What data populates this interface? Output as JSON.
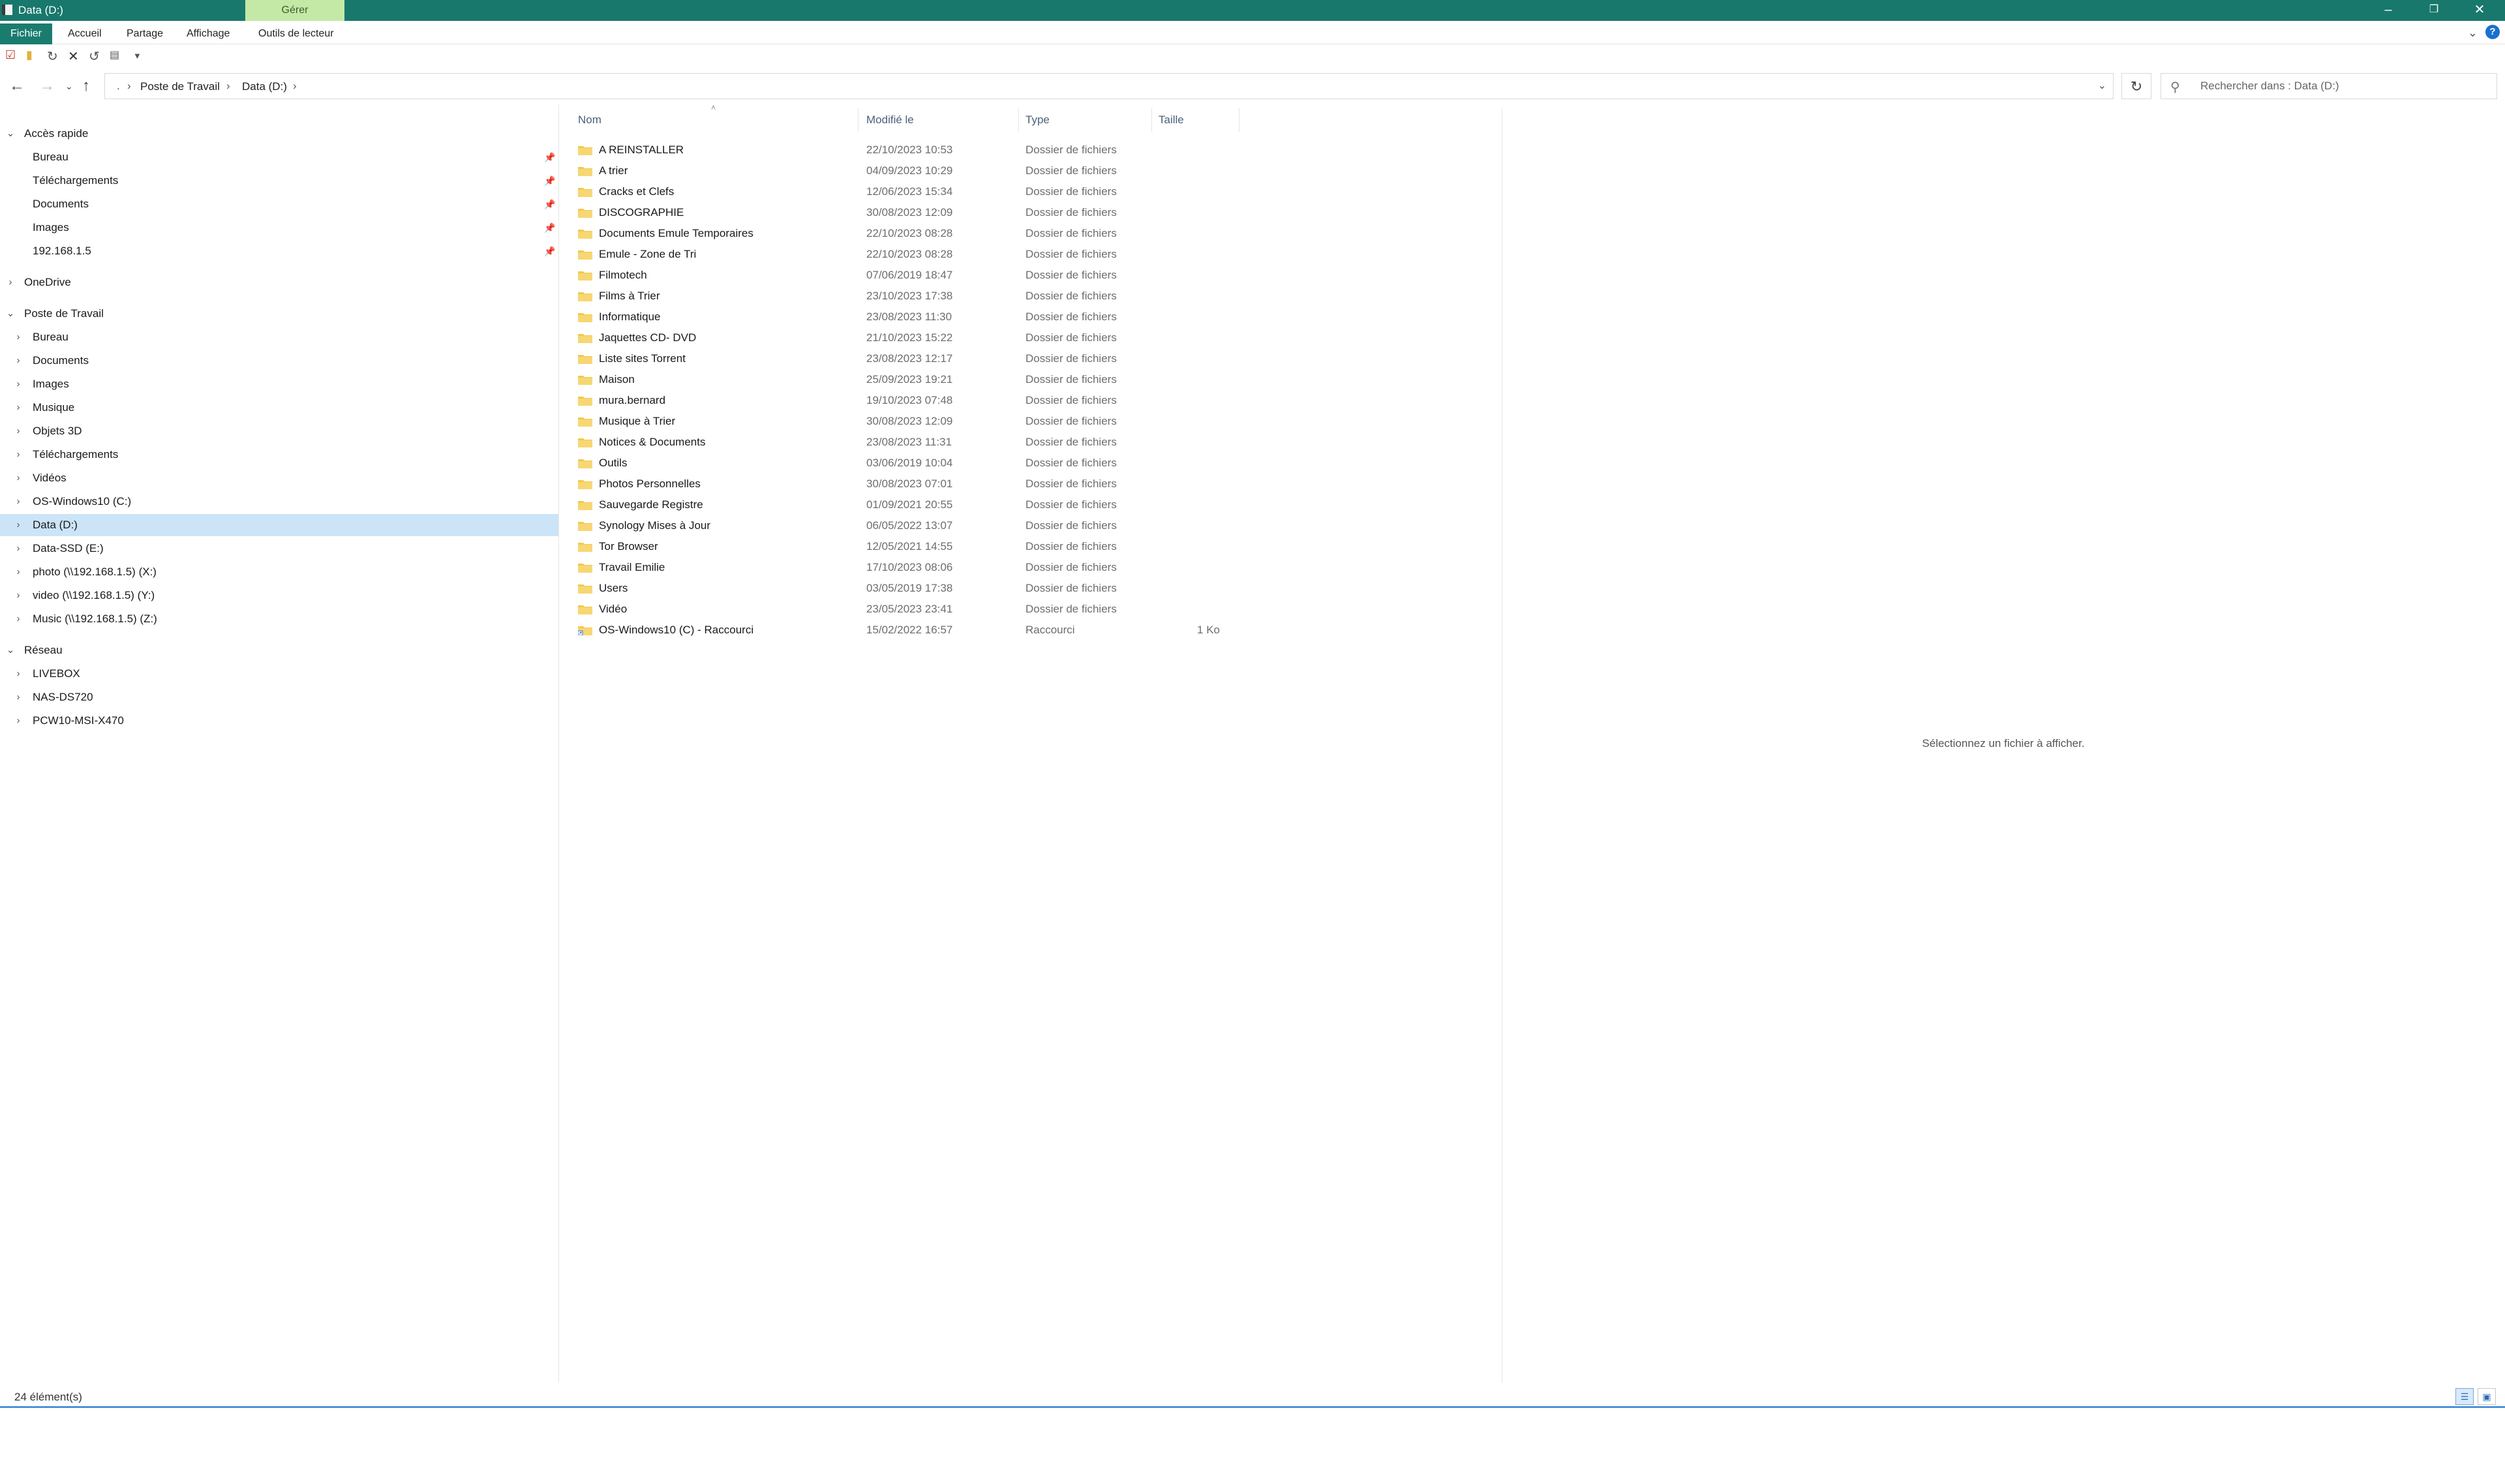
{
  "window": {
    "title": "Data (D:)",
    "context_tab": "Gérer",
    "accent_color": "#18786c"
  },
  "ribbon": {
    "tabs": [
      "Fichier",
      "Accueil",
      "Partage",
      "Affichage",
      "Outils de lecteur"
    ]
  },
  "address_bar": {
    "crumbs": [
      "Poste de Travail",
      "Data (D:)"
    ]
  },
  "search": {
    "placeholder": "Rechercher dans : Data (D:)"
  },
  "sidebar": {
    "quick_access": {
      "label": "Accès rapide",
      "items": [
        "Bureau",
        "Téléchargements",
        "Documents",
        "Images",
        "192.168.1.5"
      ]
    },
    "onedrive": "OneDrive",
    "this_pc": {
      "label": "Poste de Travail",
      "items": [
        "Bureau",
        "Documents",
        "Images",
        "Musique",
        "Objets 3D",
        "Téléchargements",
        "Vidéos",
        "OS-Windows10 (C:)",
        "Data (D:)",
        "Data-SSD (E:)",
        "photo (\\\\192.168.1.5) (X:)",
        "video (\\\\192.168.1.5) (Y:)",
        "Music (\\\\192.168.1.5) (Z:)"
      ],
      "selected": "Data (D:)"
    },
    "network": {
      "label": "Réseau",
      "items": [
        "LIVEBOX",
        "NAS-DS720",
        "PCW10-MSI-X470"
      ]
    }
  },
  "file_list": {
    "columns": [
      "Nom",
      "Modifié le",
      "Type",
      "Taille"
    ],
    "rows": [
      {
        "name": "A REINSTALLER",
        "date": "22/10/2023 10:53",
        "type": "Dossier de fichiers",
        "size": ""
      },
      {
        "name": "A trier",
        "date": "04/09/2023 10:29",
        "type": "Dossier de fichiers",
        "size": ""
      },
      {
        "name": "Cracks et Clefs",
        "date": "12/06/2023 15:34",
        "type": "Dossier de fichiers",
        "size": ""
      },
      {
        "name": "DISCOGRAPHIE",
        "date": "30/08/2023 12:09",
        "type": "Dossier de fichiers",
        "size": ""
      },
      {
        "name": "Documents Emule Temporaires",
        "date": "22/10/2023 08:28",
        "type": "Dossier de fichiers",
        "size": ""
      },
      {
        "name": "Emule - Zone de Tri",
        "date": "22/10/2023 08:28",
        "type": "Dossier de fichiers",
        "size": ""
      },
      {
        "name": "Filmotech",
        "date": "07/06/2019 18:47",
        "type": "Dossier de fichiers",
        "size": ""
      },
      {
        "name": "Films à Trier",
        "date": "23/10/2023 17:38",
        "type": "Dossier de fichiers",
        "size": ""
      },
      {
        "name": "Informatique",
        "date": "23/08/2023 11:30",
        "type": "Dossier de fichiers",
        "size": ""
      },
      {
        "name": "Jaquettes CD- DVD",
        "date": "21/10/2023 15:22",
        "type": "Dossier de fichiers",
        "size": ""
      },
      {
        "name": "Liste sites Torrent",
        "date": "23/08/2023 12:17",
        "type": "Dossier de fichiers",
        "size": ""
      },
      {
        "name": "Maison",
        "date": "25/09/2023 19:21",
        "type": "Dossier de fichiers",
        "size": ""
      },
      {
        "name": "mura.bernard",
        "date": "19/10/2023 07:48",
        "type": "Dossier de fichiers",
        "size": ""
      },
      {
        "name": "Musique à Trier",
        "date": "30/08/2023 12:09",
        "type": "Dossier de fichiers",
        "size": ""
      },
      {
        "name": "Notices & Documents",
        "date": "23/08/2023 11:31",
        "type": "Dossier de fichiers",
        "size": ""
      },
      {
        "name": "Outils",
        "date": "03/06/2019 10:04",
        "type": "Dossier de fichiers",
        "size": ""
      },
      {
        "name": "Photos Personnelles",
        "date": "30/08/2023 07:01",
        "type": "Dossier de fichiers",
        "size": ""
      },
      {
        "name": "Sauvegarde Registre",
        "date": "01/09/2021 20:55",
        "type": "Dossier de fichiers",
        "size": ""
      },
      {
        "name": "Synology Mises à Jour",
        "date": "06/05/2022 13:07",
        "type": "Dossier de fichiers",
        "size": ""
      },
      {
        "name": "Tor Browser",
        "date": "12/05/2021 14:55",
        "type": "Dossier de fichiers",
        "size": ""
      },
      {
        "name": "Travail Emilie",
        "date": "17/10/2023 08:06",
        "type": "Dossier de fichiers",
        "size": ""
      },
      {
        "name": "Users",
        "date": "03/05/2019 17:38",
        "type": "Dossier de fichiers",
        "size": ""
      },
      {
        "name": "Vidéo",
        "date": "23/05/2023 23:41",
        "type": "Dossier de fichiers",
        "size": ""
      },
      {
        "name": "OS-Windows10 (C) - Raccourci",
        "date": "15/02/2022 16:57",
        "type": "Raccourci",
        "size": "1 Ko"
      }
    ]
  },
  "preview": {
    "message": "Sélectionnez un fichier à afficher."
  },
  "status": {
    "count": "24 élément(s)"
  }
}
